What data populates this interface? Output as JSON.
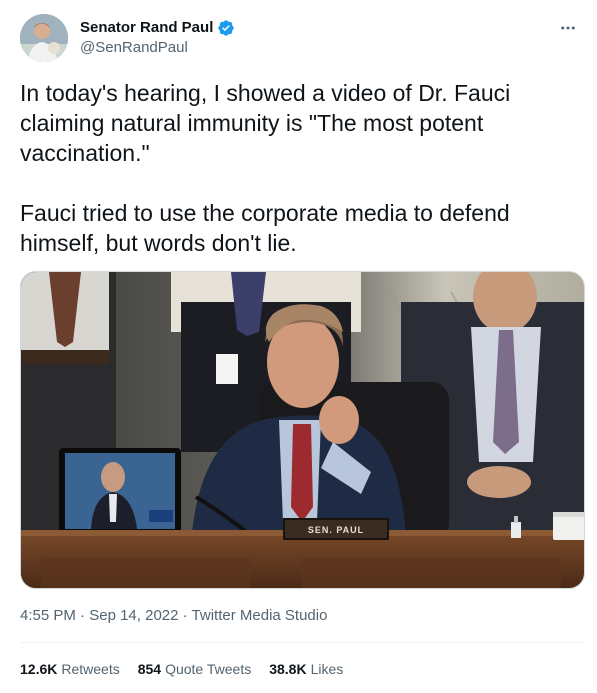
{
  "tweet": {
    "author": {
      "display_name": "Senator Rand Paul",
      "handle": "@SenRandPaul",
      "verified": true
    },
    "text": {
      "paragraph1": "In today's hearing, I showed a video of Dr. Fauci claiming natural immunity is \"The most potent vaccination.\"",
      "paragraph2": "Fauci tried to use the corporate media to defend himself, but words don't lie."
    },
    "media": {
      "nameplate": "SEN. PAUL"
    },
    "meta": {
      "time": "4:55 PM",
      "separator": "·",
      "date": "Sep 14, 2022",
      "source": "Twitter Media Studio"
    },
    "stats": {
      "retweets_count": "12.6K",
      "retweets_label": "Retweets",
      "quotes_count": "854",
      "quotes_label": "Quote Tweets",
      "likes_count": "38.8K",
      "likes_label": "Likes"
    }
  },
  "colors": {
    "text_primary": "#0f1419",
    "text_secondary": "#536471",
    "verified_blue": "#1d9bf0",
    "divider": "#eff3f4"
  }
}
